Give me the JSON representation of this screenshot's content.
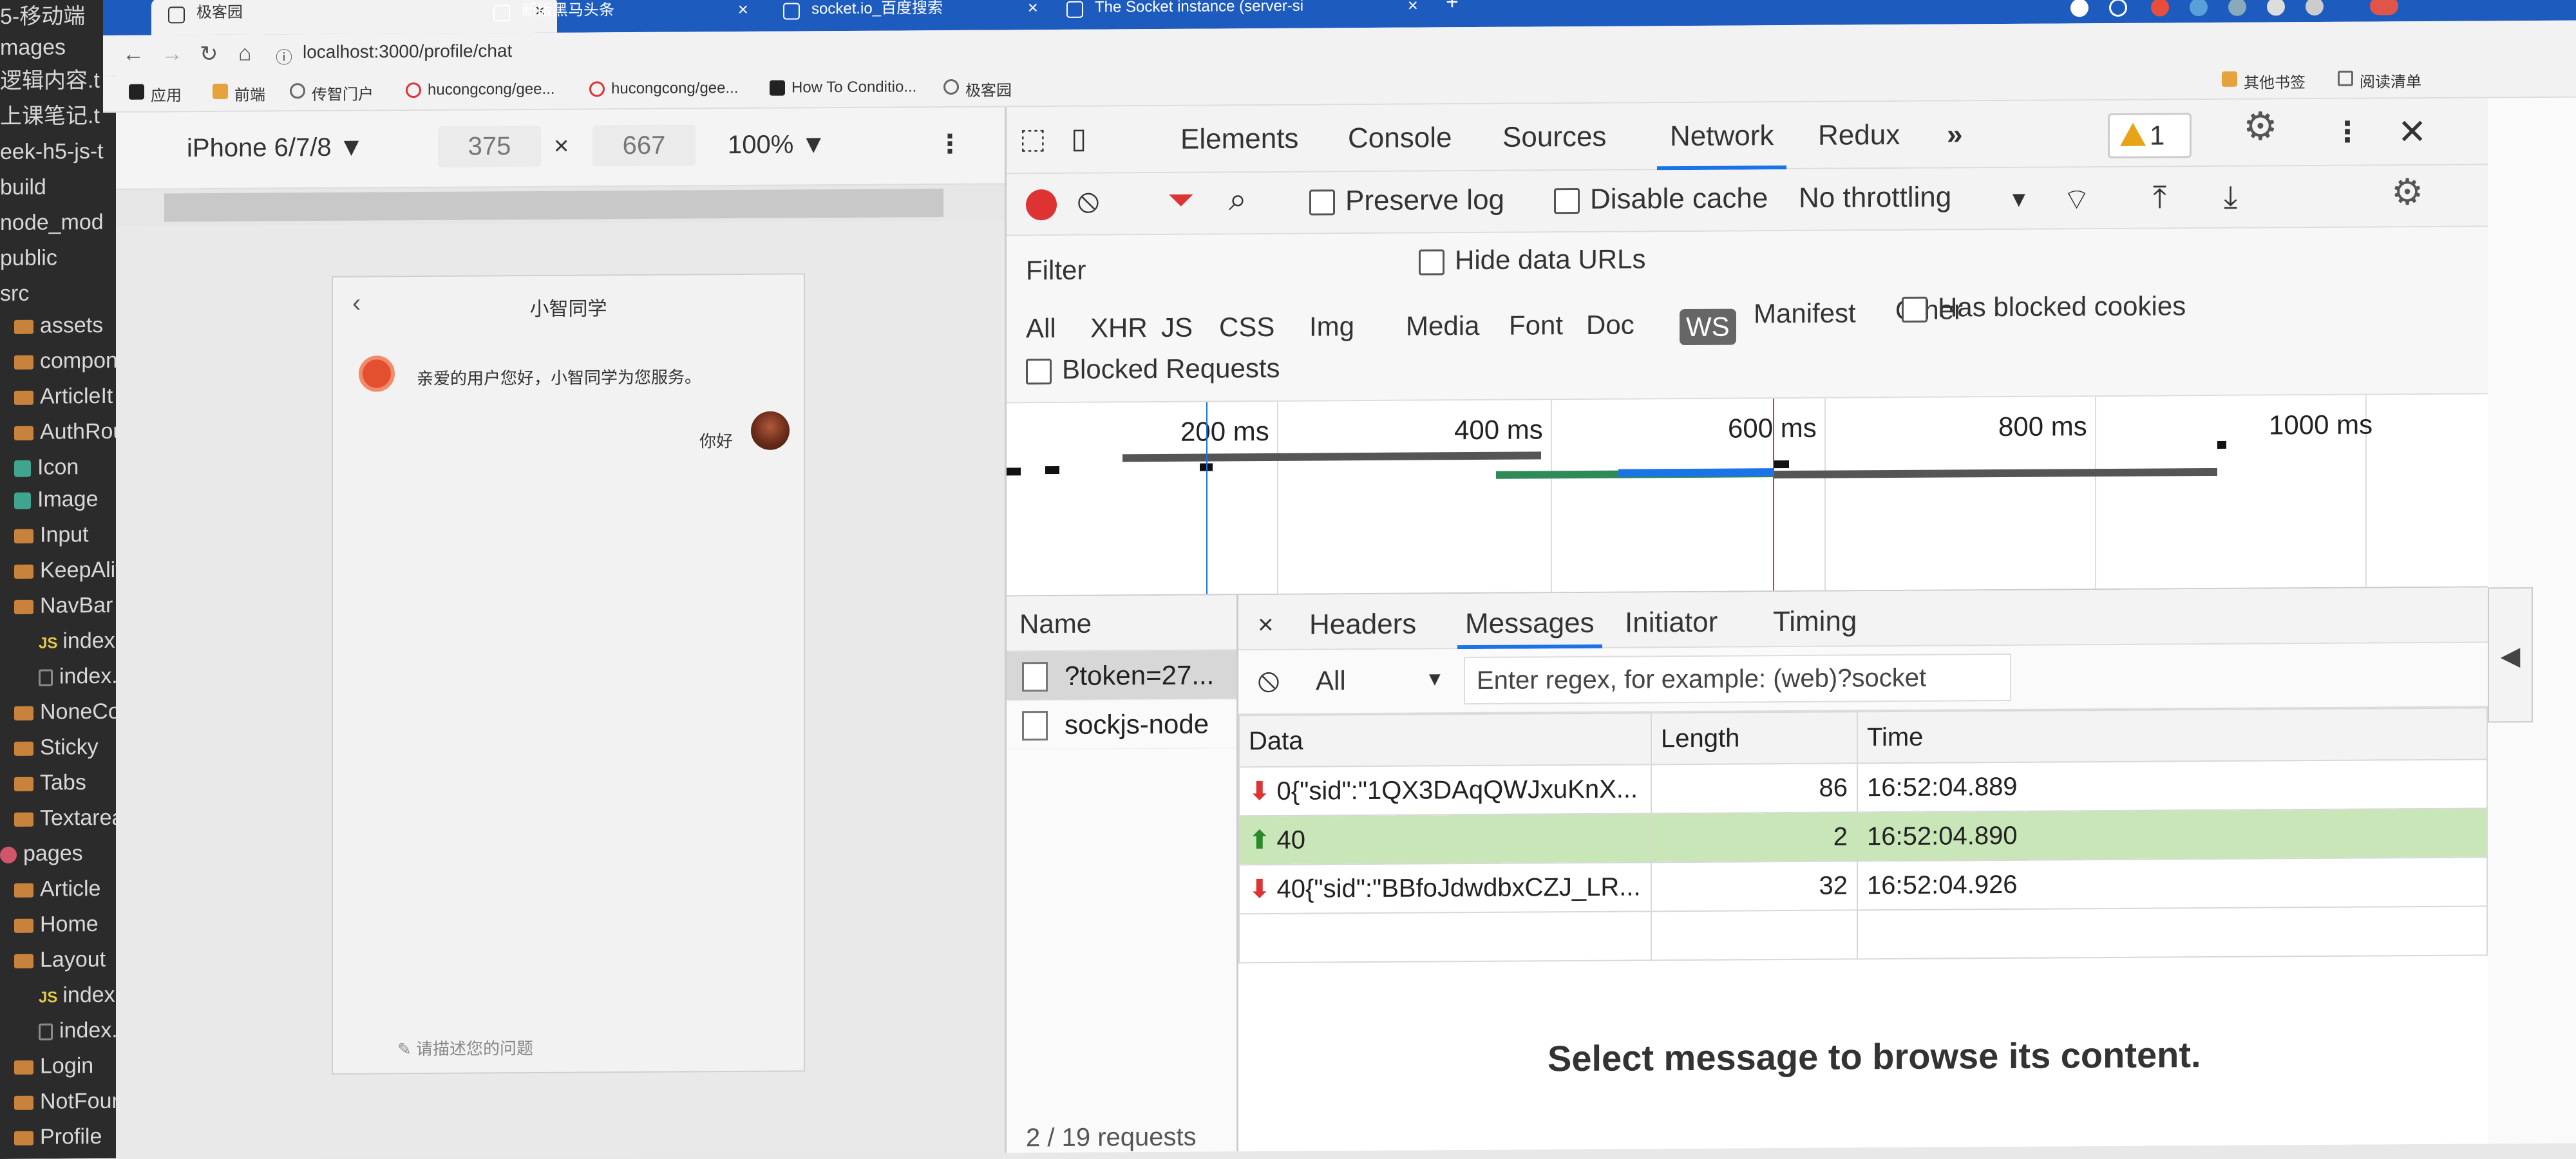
{
  "explorer": {
    "items": [
      {
        "label": "5-移动端",
        "kind": "text"
      },
      {
        "label": "mages",
        "kind": "text"
      },
      {
        "label": "逻辑内容.t",
        "kind": "text"
      },
      {
        "label": "上课笔记.t",
        "kind": "text"
      },
      {
        "label": "eek-h5-js-t",
        "kind": "text"
      },
      {
        "label": "build",
        "kind": "text"
      },
      {
        "label": "node_mod",
        "kind": "text"
      },
      {
        "label": "public",
        "kind": "text"
      },
      {
        "label": "src",
        "kind": "text"
      },
      {
        "label": "assets",
        "kind": "folder"
      },
      {
        "label": "compone",
        "kind": "folder"
      },
      {
        "label": "ArticleIt",
        "kind": "folder"
      },
      {
        "label": "AuthRou",
        "kind": "folder"
      },
      {
        "label": "Icon",
        "kind": "teal"
      },
      {
        "label": "Image",
        "kind": "teal"
      },
      {
        "label": "Input",
        "kind": "folder"
      },
      {
        "label": "KeepAliv",
        "kind": "folder"
      },
      {
        "label": "NavBar",
        "kind": "folder"
      },
      {
        "label": "index.js",
        "kind": "js"
      },
      {
        "label": "index.r",
        "kind": "file"
      },
      {
        "label": "NoneCo",
        "kind": "folder"
      },
      {
        "label": "Sticky",
        "kind": "folder"
      },
      {
        "label": "Tabs",
        "kind": "folder"
      },
      {
        "label": "Textarea",
        "kind": "folder"
      },
      {
        "label": "pages",
        "kind": "pink"
      },
      {
        "label": "Article",
        "kind": "folder"
      },
      {
        "label": "Home",
        "kind": "folder"
      },
      {
        "label": "Layout",
        "kind": "folder"
      },
      {
        "label": "index.js",
        "kind": "js"
      },
      {
        "label": "index.r",
        "kind": "file"
      },
      {
        "label": "Login",
        "kind": "folder"
      },
      {
        "label": "NotFour",
        "kind": "folder"
      },
      {
        "label": "Profile",
        "kind": "folder"
      }
    ]
  },
  "browser": {
    "tabs": [
      {
        "label": "极客园",
        "active": true
      },
      {
        "label": "新版黑马头条",
        "active": false
      },
      {
        "label": "socket.io_百度搜索",
        "active": false
      },
      {
        "label": "The Socket instance (server-si",
        "active": false
      }
    ],
    "url": "localhost:3000/profile/chat",
    "bookmarks": [
      "应用",
      "前端",
      "传智门户",
      "hucongcong/gee...",
      "hucongcong/gee...",
      "How To Conditio...",
      "极客园"
    ],
    "right_bookmarks": [
      "其他书签",
      "阅读清单"
    ]
  },
  "device": {
    "name": "iPhone 6/7/8 ▼",
    "width": "375",
    "times": "×",
    "height": "667",
    "zoom": "100% ▼"
  },
  "phone": {
    "title": "小智同学",
    "bot_message": "亲爱的用户您好，小智同学为您服务。",
    "my_message": "你好",
    "input_placeholder": "✎ 请描述您的问题"
  },
  "devtools": {
    "tabs": [
      "Elements",
      "Console",
      "Sources",
      "Network",
      "Redux",
      "»"
    ],
    "active_tab": "Network",
    "warnings": "1",
    "preserve_log": "Preserve log",
    "disable_cache": "Disable cache",
    "throttling": "No throttling",
    "filter_label": "Filter",
    "hide_data_urls": "Hide data URLs",
    "types": [
      "All",
      "XHR",
      "JS",
      "CSS",
      "Img",
      "Media",
      "Font",
      "Doc",
      "WS",
      "Manifest",
      "Other"
    ],
    "active_type": "WS",
    "has_blocked_cookies": "Has blocked cookies",
    "blocked_requests": "Blocked Requests",
    "timeline_labels": [
      "200 ms",
      "400 ms",
      "600 ms",
      "800 ms",
      "1000 ms"
    ]
  },
  "requests": {
    "header": "Name",
    "items": [
      "?token=27...",
      "sockjs-node"
    ],
    "footer": "2 / 19 requests"
  },
  "messages": {
    "tabs": [
      "×",
      "Headers",
      "Messages",
      "Initiator",
      "Timing"
    ],
    "filter_select": "All",
    "regex_placeholder": "Enter regex, for example: (web)?socket",
    "columns": [
      "Data",
      "Length",
      "Time"
    ],
    "rows": [
      {
        "dir": "in",
        "arrow": "⬇",
        "data": "0{\"sid\":\"1QX3DAqQWJxuKnX...",
        "length": "86",
        "time": "16:52:04.889"
      },
      {
        "dir": "out",
        "arrow": "⬆",
        "data": "40",
        "length": "2",
        "time": "16:52:04.890"
      },
      {
        "dir": "in",
        "arrow": "⬇",
        "data": "40{\"sid\":\"BBfoJdwdbxCZJ_LR...",
        "length": "32",
        "time": "16:52:04.926"
      }
    ],
    "empty_text": "Select message to browse its content."
  }
}
